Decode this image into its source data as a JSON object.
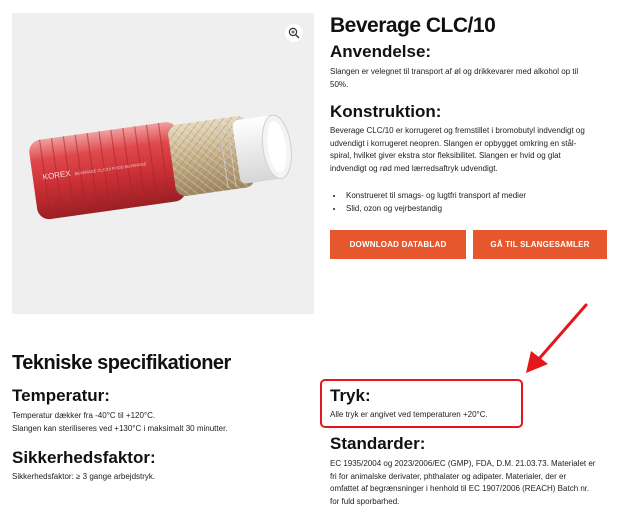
{
  "product": {
    "title": "Beverage CLC/10",
    "image_brand": "KOREX",
    "image_print": "BEVERAGE CLC/10 FOOD BEVERAGE"
  },
  "anvendelse": {
    "heading": "Anvendelse:",
    "lines": [
      "Slangen er velegnet til transport af øl og drikkevarer med alkohol op til",
      "50%."
    ]
  },
  "konstruktion": {
    "heading": "Konstruktion:",
    "lines": [
      "Beverage CLC/10 er korrugeret og fremstillet i bromobutyl indvendigt og",
      "udvendigt i korrugeret neopren. Slangen er opbygget omkring en stål-",
      "spiral, hvilket giver ekstra stor fleksibilitet. Slangen er hvid og glat",
      "indvendigt og rød med lærredsaftryk udvendigt."
    ],
    "bullets": [
      "Konstrueret til smags- og lugtfri transport af medier",
      "Slid, ozon og vejrbestandig"
    ]
  },
  "buttons": {
    "download": "DOWNLOAD DATABLAD",
    "slangesamler": "GÅ TIL SLANGESAMLER",
    "color": "#e7572d"
  },
  "specs": {
    "title": "Tekniske specifikationer",
    "temperatur": {
      "heading": "Temperatur:",
      "lines": [
        "Temperatur dækker fra -40°C til +120°C.",
        "Slangen kan steriliseres ved +130°C i maksimalt 30 minutter."
      ]
    },
    "sikkerhed": {
      "heading": "Sikkerhedsfaktor:",
      "text": "Sikkerhedsfaktor: ≥ 3 gange arbejdstryk."
    },
    "tryk": {
      "heading": "Tryk:",
      "text": "Alle tryk er angivet ved temperaturen +20°C."
    },
    "standarder": {
      "heading": "Standarder:",
      "lines": [
        "EC 1935/2004 og 2023/2006/EC (GMP), FDA, D.M. 21.03.73. Materialet er",
        "fri for animalske derivater, phthalater og adipater. Materialer, der er",
        "omfattet af begrænsninger i henhold til EC 1907/2006 (REACH) Batch nr.",
        "for fuld sporbarhed."
      ]
    }
  },
  "annotation_color": "#e5161c"
}
